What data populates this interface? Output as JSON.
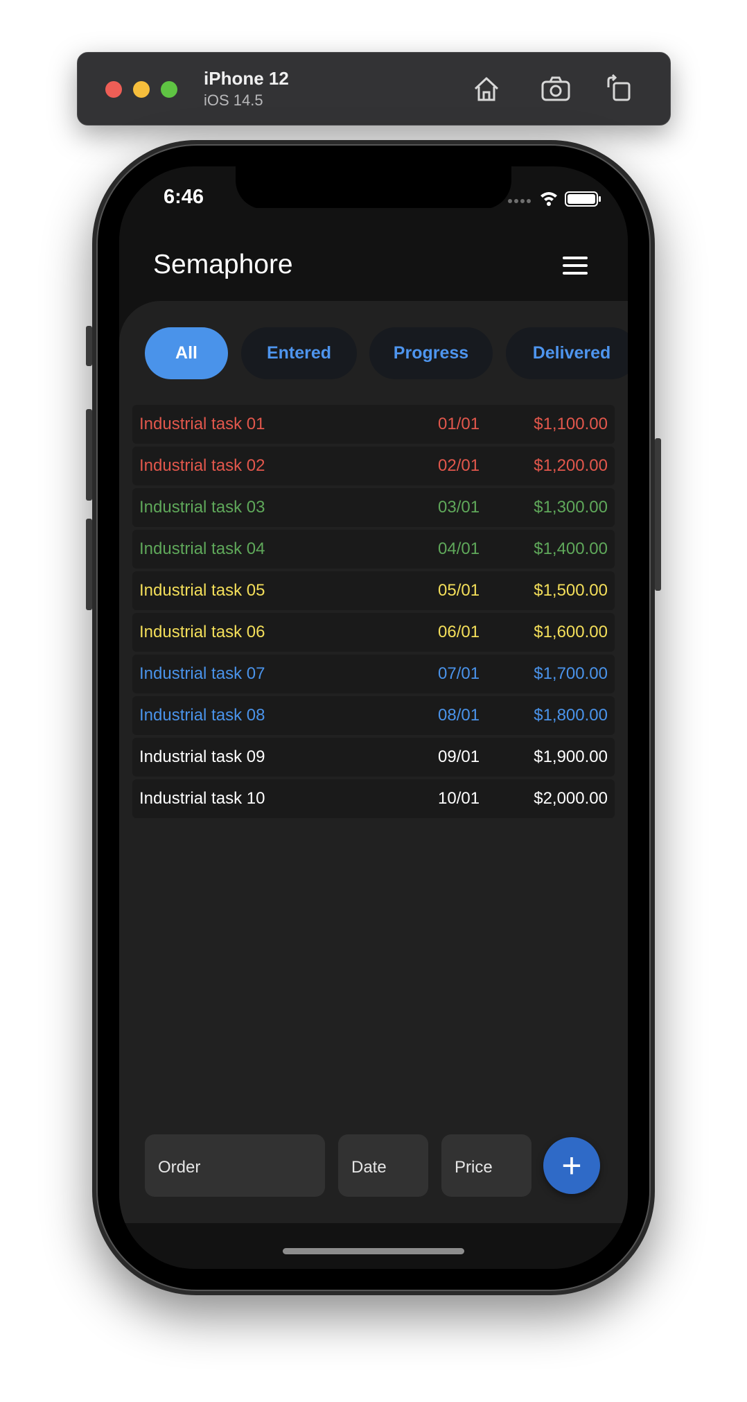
{
  "simulator": {
    "device": "iPhone 12",
    "os": "iOS 14.5",
    "icons": [
      "home-icon",
      "screenshot-icon",
      "rotate-icon"
    ]
  },
  "status_bar": {
    "time": "6:46"
  },
  "app": {
    "title": "Semaphore",
    "menu_icon": "hamburger-menu-icon"
  },
  "filters": [
    {
      "label": "All",
      "active": true
    },
    {
      "label": "Entered",
      "active": false
    },
    {
      "label": "Progress",
      "active": false
    },
    {
      "label": "Delivered",
      "active": false
    }
  ],
  "tasks": [
    {
      "name": "Industrial task 01",
      "date": "01/01",
      "price": "$1,100.00",
      "color": "#e2574c"
    },
    {
      "name": "Industrial task 02",
      "date": "02/01",
      "price": "$1,200.00",
      "color": "#e2574c"
    },
    {
      "name": "Industrial task 03",
      "date": "03/01",
      "price": "$1,300.00",
      "color": "#5fa85a"
    },
    {
      "name": "Industrial task 04",
      "date": "04/01",
      "price": "$1,400.00",
      "color": "#5fa85a"
    },
    {
      "name": "Industrial task 05",
      "date": "05/01",
      "price": "$1,500.00",
      "color": "#f4df5a"
    },
    {
      "name": "Industrial task 06",
      "date": "06/01",
      "price": "$1,600.00",
      "color": "#f4df5a"
    },
    {
      "name": "Industrial task 07",
      "date": "07/01",
      "price": "$1,700.00",
      "color": "#4a93ea"
    },
    {
      "name": "Industrial task 08",
      "date": "08/01",
      "price": "$1,800.00",
      "color": "#4a93ea"
    },
    {
      "name": "Industrial task 09",
      "date": "09/01",
      "price": "$1,900.00",
      "color": "#ffffff"
    },
    {
      "name": "Industrial task 10",
      "date": "10/01",
      "price": "$2,000.00",
      "color": "#ffffff"
    }
  ],
  "form": {
    "order_placeholder": "Order",
    "date_placeholder": "Date",
    "price_placeholder": "Price",
    "add_label": "+"
  }
}
